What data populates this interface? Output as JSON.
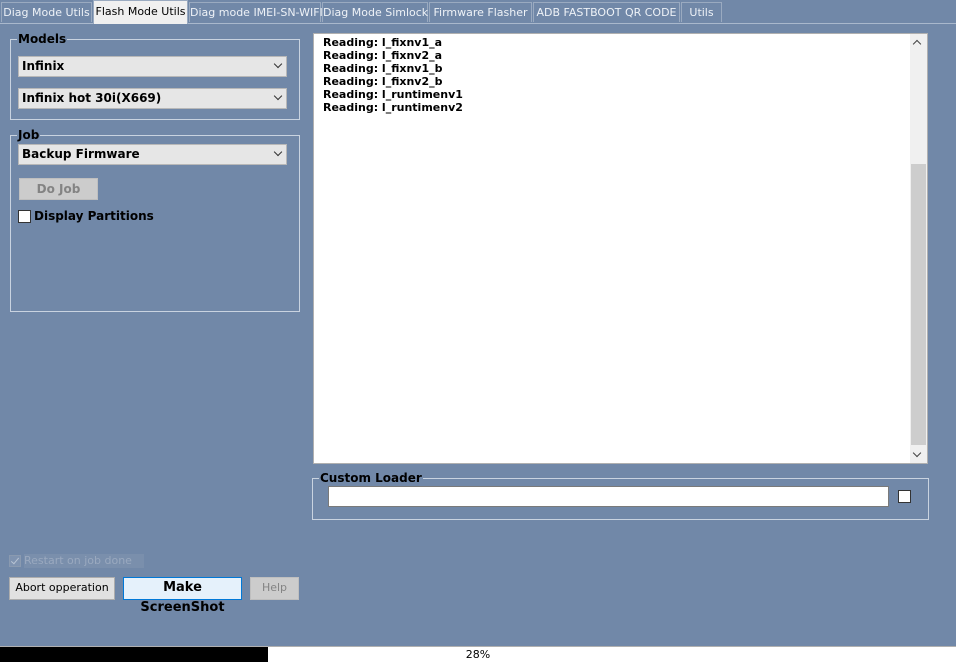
{
  "tabs": [
    {
      "label": "Diag Mode Utils",
      "active": false
    },
    {
      "label": "Flash Mode Utils",
      "active": true
    },
    {
      "label": "Diag mode IMEI-SN-WIFI",
      "active": false
    },
    {
      "label": "Diag Mode Simlock",
      "active": false
    },
    {
      "label": "Firmware Flasher",
      "active": false
    },
    {
      "label": "ADB FASTBOOT QR CODE",
      "active": false
    },
    {
      "label": "Utils",
      "active": false
    }
  ],
  "models": {
    "legend": "Models",
    "brand": "Infinix",
    "model": "Infinix hot 30i(X669)"
  },
  "job": {
    "legend": "Job",
    "selected": "Backup Firmware",
    "do_job_label": "Do Job",
    "display_partitions_label": "Display Partitions",
    "display_partitions_checked": false
  },
  "log": {
    "lines": [
      "Reading: l_fixnv1_a",
      "Reading: l_fixnv2_a",
      "Reading: l_fixnv1_b",
      "Reading: l_fixnv2_b",
      "Reading: l_runtimenv1",
      "Reading: l_runtimenv2"
    ]
  },
  "custom_loader": {
    "legend": "Custom Loader",
    "value": "",
    "checked": false
  },
  "footer": {
    "restart_label": "Restart on job done",
    "restart_checked": true,
    "abort_label": "Abort opperation",
    "screenshot_label": "Make ScreenShot",
    "help_label": "Help"
  },
  "progress": {
    "percent": 28,
    "label": "28%"
  }
}
